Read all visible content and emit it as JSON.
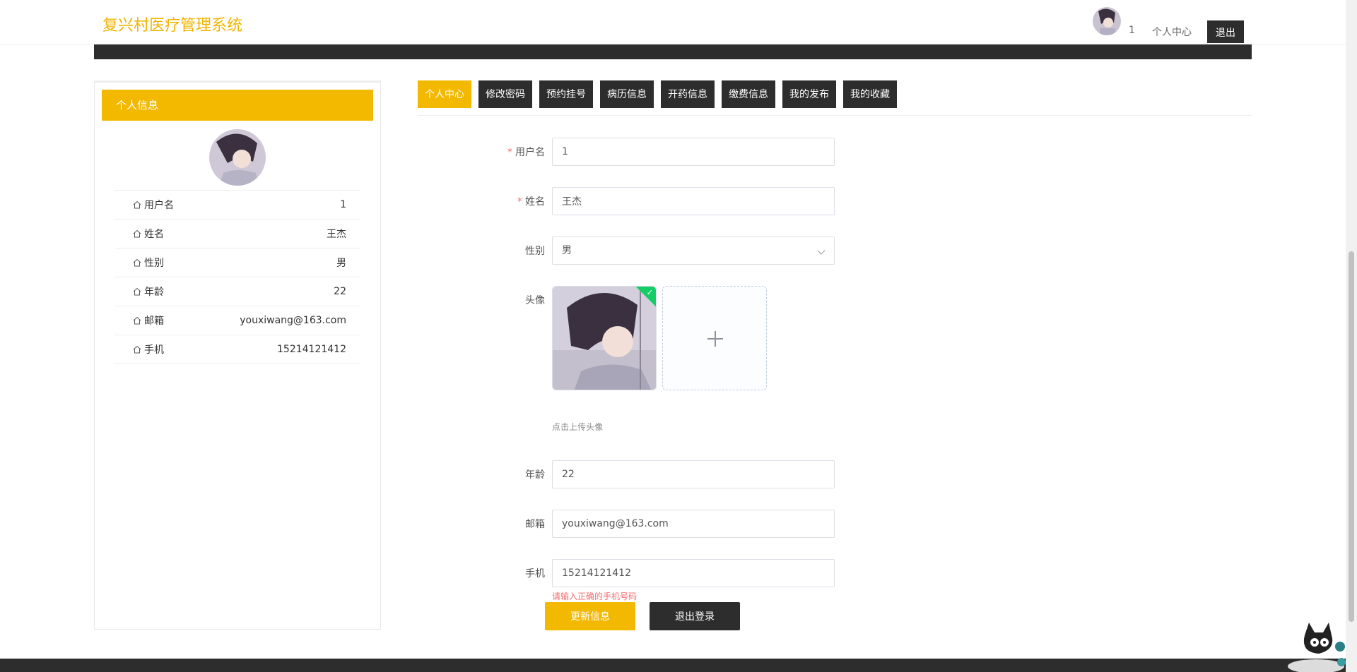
{
  "header": {
    "logo": "复兴村医疗管理系统",
    "user_id": "1",
    "center_link": "个人中心",
    "logout": "退出"
  },
  "profile_card": {
    "title": "个人信息",
    "rows": [
      {
        "label": "用户名",
        "value": "1"
      },
      {
        "label": "姓名",
        "value": "王杰"
      },
      {
        "label": "性别",
        "value": "男"
      },
      {
        "label": "年龄",
        "value": "22"
      },
      {
        "label": "邮箱",
        "value": "youxiwang@163.com"
      },
      {
        "label": "手机",
        "value": "15214121412"
      }
    ]
  },
  "tabs": [
    "个人中心",
    "修改密码",
    "预约挂号",
    "病历信息",
    "开药信息",
    "缴费信息",
    "我的发布",
    "我的收藏"
  ],
  "form": {
    "username": {
      "label": "用户名",
      "value": "1"
    },
    "name": {
      "label": "姓名",
      "value": "王杰"
    },
    "gender": {
      "label": "性别",
      "value": "男"
    },
    "avatar": {
      "label": "头像",
      "tip": "点击上传头像"
    },
    "age": {
      "label": "年龄",
      "value": "22"
    },
    "email": {
      "label": "邮箱",
      "value": "youxiwang@163.com"
    },
    "phone": {
      "label": "手机",
      "value": "15214121412",
      "error": "请输入正确的手机号码"
    },
    "update_button": "更新信息",
    "logout_button": "退出登录"
  },
  "colors": {
    "accent": "#f3b800",
    "dark": "#2d2d2d",
    "error": "#f56c6c",
    "success": "#13ce66"
  }
}
